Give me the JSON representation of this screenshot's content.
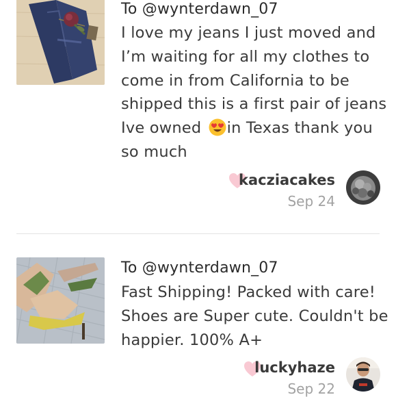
{
  "reviews": [
    {
      "recipient": "To @wynterdawn_07",
      "text_before_emoji": "I love my jeans I just moved and I’m waiting for all my clothes to come in from California to be shipped this is a first pair of jeans Ive owned ",
      "emoji": "heart-eyes-emoji",
      "text_after_emoji": "in Texas thank you so much",
      "username": "kacziacakes",
      "date": "Sep 24",
      "thumbnail": "jeans-photo",
      "avatar": "user-avatar-photo"
    },
    {
      "recipient": "To @wynterdawn_07",
      "text": "Fast Shipping! Packed with care! Shoes are Super cute. Couldn't be happier. 100% A+",
      "username": "luckyhaze",
      "date": "Sep 22",
      "thumbnail": "shoes-photo",
      "avatar": "user-avatar-photo"
    }
  ],
  "colors": {
    "heart": "#f9c9d3",
    "username": "#3a3a3a",
    "date": "#a2a2a2",
    "divider": "#e2e2e2"
  }
}
